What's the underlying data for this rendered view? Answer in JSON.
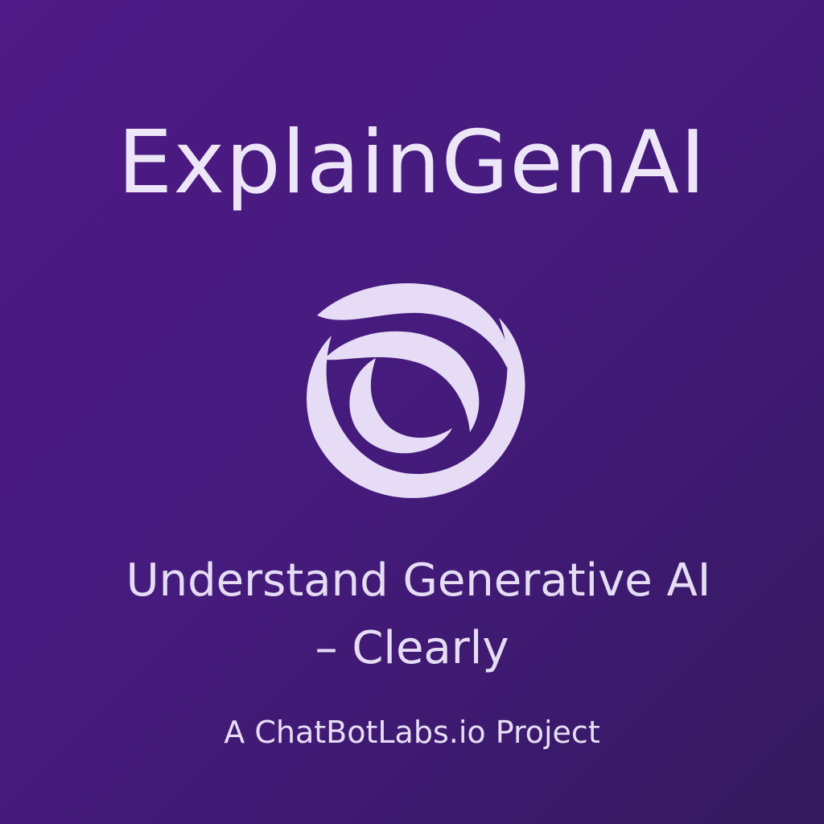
{
  "title": "ExplainGenAI",
  "logo": {
    "icon": "swirl-icon",
    "color": "#e7dcf5"
  },
  "subtitle": {
    "line1": "Understand Generative AI",
    "line2": "– Clearly"
  },
  "tagline": "A ChatBotLabs.io Project",
  "colors": {
    "background_start": "#4e1a85",
    "background_end": "#341a5c",
    "text": "#ede6f8"
  }
}
